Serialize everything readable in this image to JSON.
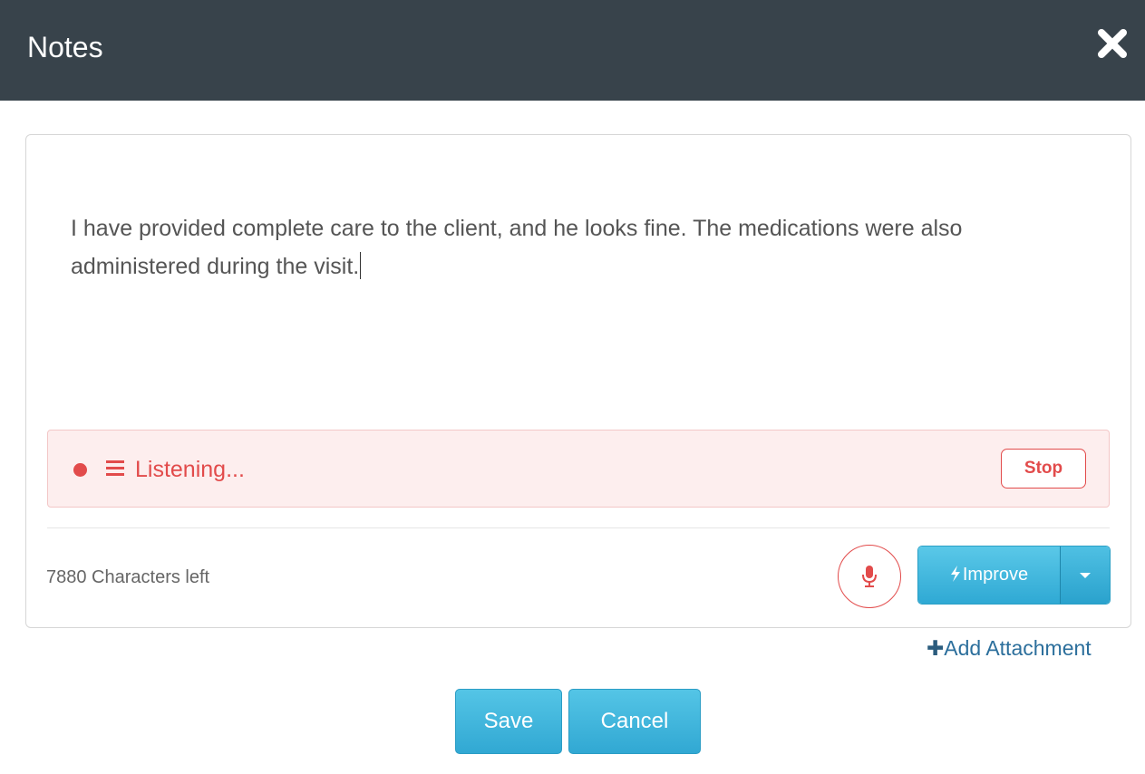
{
  "header": {
    "title": "Notes",
    "close_icon": "close-icon"
  },
  "note": {
    "text": "I have provided complete care to the client, and he looks fine. The medications were also administered during the visit."
  },
  "listening": {
    "status_text": "Listening...",
    "stop_label": "Stop",
    "color": "#e24b4b"
  },
  "footer": {
    "chars_left": "7880 Characters left",
    "improve_label": "Improve",
    "add_attachment_label": "Add Attachment"
  },
  "actions": {
    "save_label": "Save",
    "cancel_label": "Cancel"
  },
  "colors": {
    "header_bg": "#38434b",
    "primary_button": "#31a8d3",
    "recording_red": "#e24b4b"
  }
}
